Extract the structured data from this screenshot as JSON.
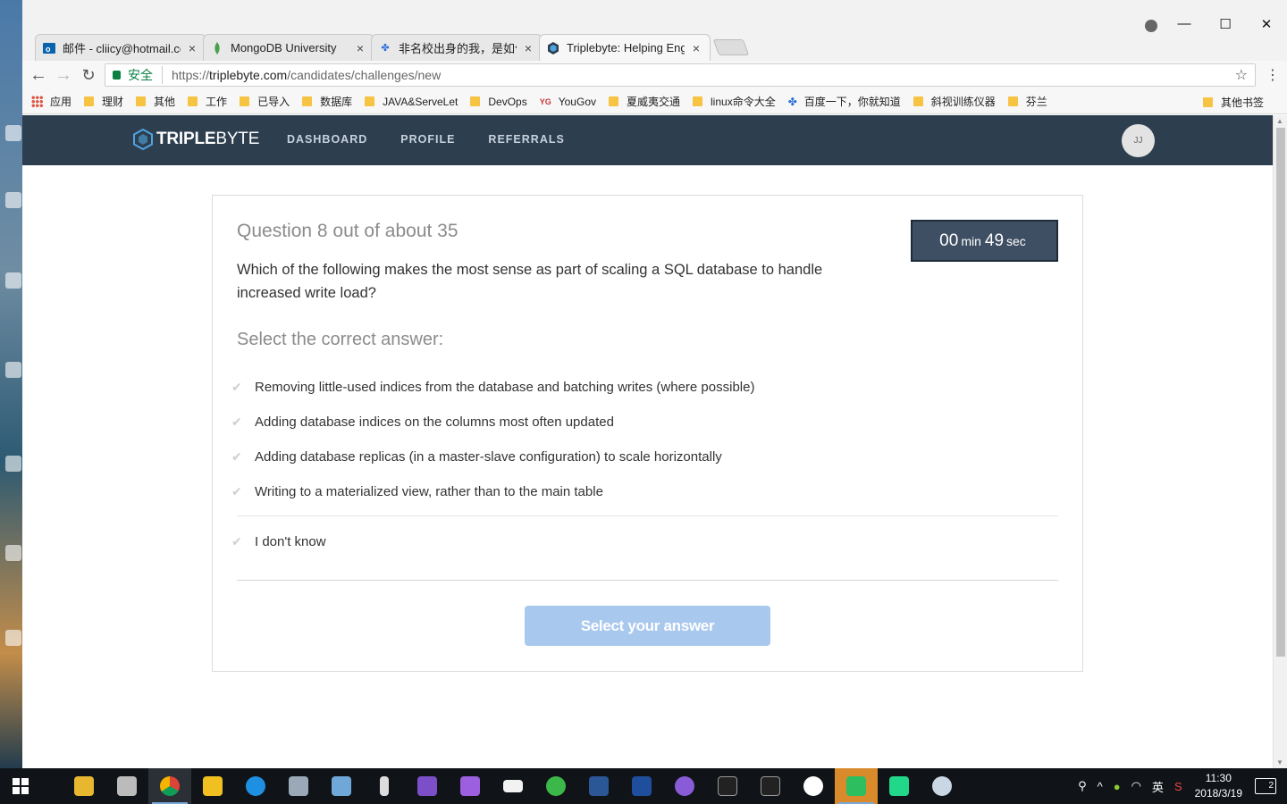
{
  "browser": {
    "tabs": [
      {
        "label": "邮件 - cliicy@hotmail.co",
        "favicon": "outlook-icon",
        "active": false
      },
      {
        "label": "MongoDB University",
        "favicon": "mongodb-leaf-icon",
        "active": false
      },
      {
        "label": "非名校出身的我，是如何",
        "favicon": "baidu-paw-icon",
        "active": false
      },
      {
        "label": "Triplebyte: Helping Eng",
        "favicon": "triplebyte-hex-icon",
        "active": true
      }
    ],
    "secure_label": "安全",
    "url_scheme": "https://",
    "url_host": "triplebyte.com",
    "url_path": "/candidates/challenges/new",
    "bookmarks": [
      {
        "label": "应用",
        "icon": "apps-icon"
      },
      {
        "label": "理财",
        "icon": "folder-icon"
      },
      {
        "label": "其他",
        "icon": "folder-icon"
      },
      {
        "label": "工作",
        "icon": "folder-icon"
      },
      {
        "label": "已导入",
        "icon": "folder-icon"
      },
      {
        "label": "数据库",
        "icon": "folder-icon"
      },
      {
        "label": "JAVA&ServeLet",
        "icon": "folder-icon"
      },
      {
        "label": "DevOps",
        "icon": "folder-icon"
      },
      {
        "label": "YouGov",
        "icon": "yougov-icon"
      },
      {
        "label": "夏威夷交通",
        "icon": "folder-icon"
      },
      {
        "label": "linux命令大全",
        "icon": "folder-icon"
      },
      {
        "label": "百度一下，你就知道",
        "icon": "baidu-paw-icon"
      },
      {
        "label": "斜视训练仪器",
        "icon": "folder-icon"
      },
      {
        "label": "芬兰",
        "icon": "folder-icon"
      }
    ],
    "bookmarks_more": "»",
    "other_bookmarks": "其他书签"
  },
  "site": {
    "logo_bold": "TRIPLE",
    "logo_light": "BYTE",
    "nav": [
      "DASHBOARD",
      "PROFILE",
      "REFERRALS"
    ],
    "avatar_initials": "JJ"
  },
  "quiz": {
    "counter": "Question 8 out of about 35",
    "timer_min": "00",
    "timer_min_unit": "min",
    "timer_sec": "49",
    "timer_sec_unit": "sec",
    "question": "Which of the following makes the most sense as part of scaling a SQL database to handle increased write load?",
    "select_heading": "Select the correct answer:",
    "answers": [
      "Removing little-used indices from the database and batching writes (where possible)",
      "Adding database indices on the columns most often updated",
      "Adding database replicas (in a master-slave configuration) to scale horizontally",
      "Writing to a materialized view, rather than to the main table"
    ],
    "dont_know": "I don't know",
    "submit_label": "Select your answer"
  },
  "taskbar": {
    "ime": "英",
    "time": "11:30",
    "date": "2018/3/19",
    "notifications": "2"
  },
  "colors": {
    "nav_bg": "#2d3e4f",
    "timer_bg": "#3e4f63",
    "submit_bg": "#a9c8ee",
    "logo_accent": "#4fa3e0"
  }
}
